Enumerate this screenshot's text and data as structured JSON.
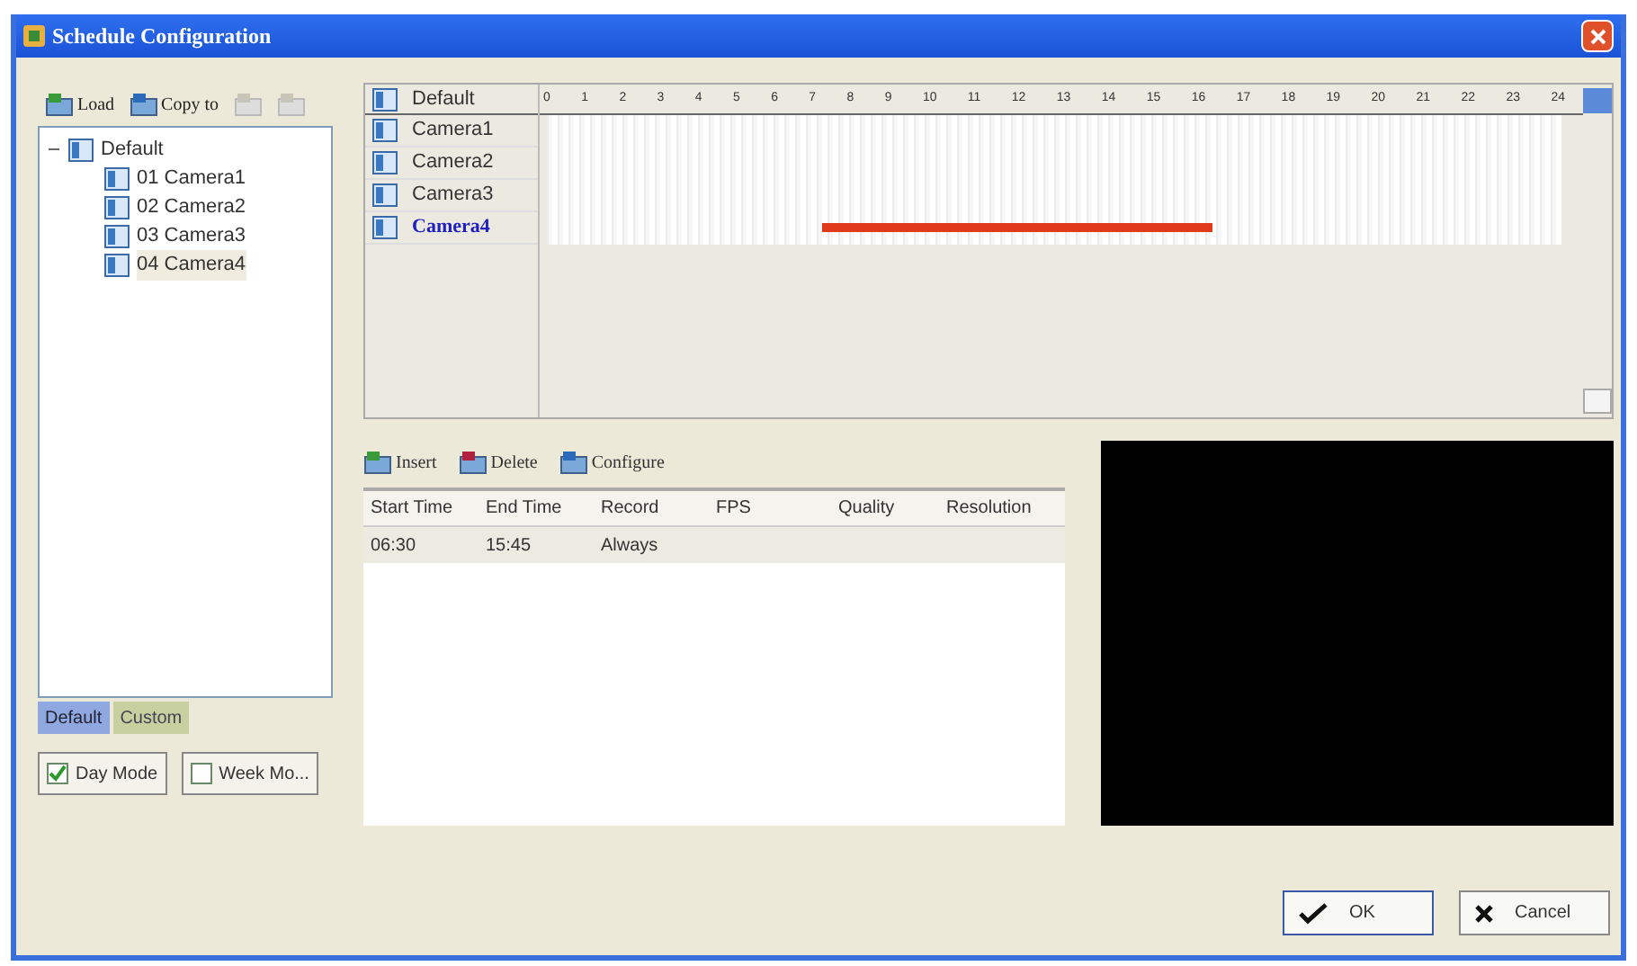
{
  "window": {
    "title": "Schedule Configuration"
  },
  "left_toolbar": [
    {
      "label": "Load",
      "kind": "load",
      "disabled": false
    },
    {
      "label": "Copy to",
      "kind": "copy",
      "disabled": false
    },
    {
      "kind": "paste",
      "disabled": true
    },
    {
      "kind": "cut",
      "disabled": true
    }
  ],
  "tree": {
    "label": "Default",
    "expanded": true,
    "children": [
      {
        "label": "01 Camera1",
        "selected": false
      },
      {
        "label": "02 Camera2",
        "selected": false
      },
      {
        "label": "03 Camera3",
        "selected": false
      },
      {
        "label": "04 Camera4",
        "selected": true
      }
    ]
  },
  "left_tabs": [
    {
      "label": "Default",
      "selected": true
    },
    {
      "label": "Custom",
      "selected": false
    }
  ],
  "modes": [
    {
      "label": "Day Mode",
      "checked": true
    },
    {
      "label": "Week Mo...",
      "checked": false
    }
  ],
  "timeline": {
    "header": "Default",
    "hours": [
      "0",
      "1",
      "2",
      "3",
      "4",
      "5",
      "6",
      "7",
      "8",
      "9",
      "10",
      "11",
      "12",
      "13",
      "14",
      "15",
      "16",
      "17",
      "18",
      "19",
      "20",
      "21",
      "22",
      "23",
      "24"
    ],
    "cameras": [
      {
        "name": "Camera1",
        "selected": false
      },
      {
        "name": "Camera2",
        "selected": false
      },
      {
        "name": "Camera3",
        "selected": false
      },
      {
        "name": "Camera4",
        "selected": true
      }
    ]
  },
  "schedule_toolbar": [
    "Insert",
    "Delete",
    "Configure"
  ],
  "table": {
    "columns": [
      "Start Time",
      "End Time",
      "Record",
      "FPS",
      "Quality",
      "Resolution"
    ],
    "rows": [
      {
        "cells": [
          "06:30",
          "15:45",
          "Always"
        ],
        "selected": true
      }
    ]
  },
  "buttons": [
    {
      "label": "OK",
      "kind": "ok"
    },
    {
      "label": "Cancel",
      "kind": "cancel"
    }
  ]
}
